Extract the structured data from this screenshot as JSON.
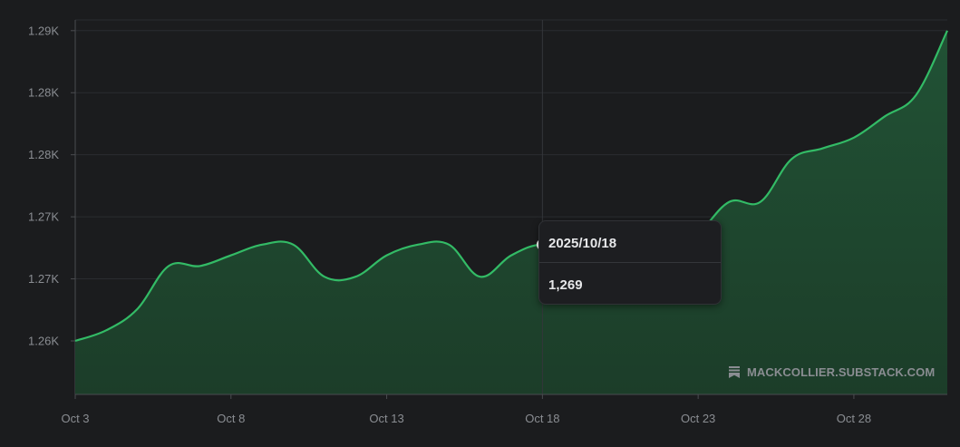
{
  "chart_data": {
    "type": "area",
    "title": "",
    "xlabel": "",
    "ylabel": "",
    "x": [
      "Oct 3",
      "Oct 4",
      "Oct 5",
      "Oct 6",
      "Oct 7",
      "Oct 8",
      "Oct 9",
      "Oct 10",
      "Oct 11",
      "Oct 12",
      "Oct 13",
      "Oct 14",
      "Oct 15",
      "Oct 16",
      "Oct 17",
      "Oct 18",
      "Oct 19",
      "Oct 20",
      "Oct 21",
      "Oct 22",
      "Oct 23",
      "Oct 24",
      "Oct 25",
      "Oct 26",
      "Oct 27",
      "Oct 28",
      "Oct 29",
      "Oct 30",
      "Oct 31"
    ],
    "series": [
      {
        "values": [
          1260,
          1261,
          1263,
          1267,
          1267,
          1268,
          1269,
          1269,
          1266,
          1266,
          1268,
          1269,
          1269,
          1266,
          1268,
          1269,
          1268,
          1267,
          1268,
          1268,
          1270,
          1273,
          1273,
          1277,
          1278,
          1279,
          1281,
          1283,
          1289
        ]
      }
    ],
    "x_ticks": [
      "Oct 3",
      "Oct 8",
      "Oct 13",
      "Oct 18",
      "Oct 23",
      "Oct 28"
    ],
    "y_ticks": [
      "1.26K",
      "1.27K",
      "1.27K",
      "1.28K",
      "1.28K",
      "1.29K"
    ],
    "ylim": [
      1255,
      1290
    ],
    "grid": true,
    "colors": {
      "line": "#33bb66",
      "fill": "#1f4a30",
      "background": "#1b1c1e"
    },
    "highlight": {
      "index": 15
    }
  },
  "tooltip": {
    "date": "2025/10/18",
    "value": "1,269"
  },
  "watermark": {
    "text": "MACKCOLLIER.SUBSTACK.COM",
    "icon": "bookmark-icon"
  }
}
